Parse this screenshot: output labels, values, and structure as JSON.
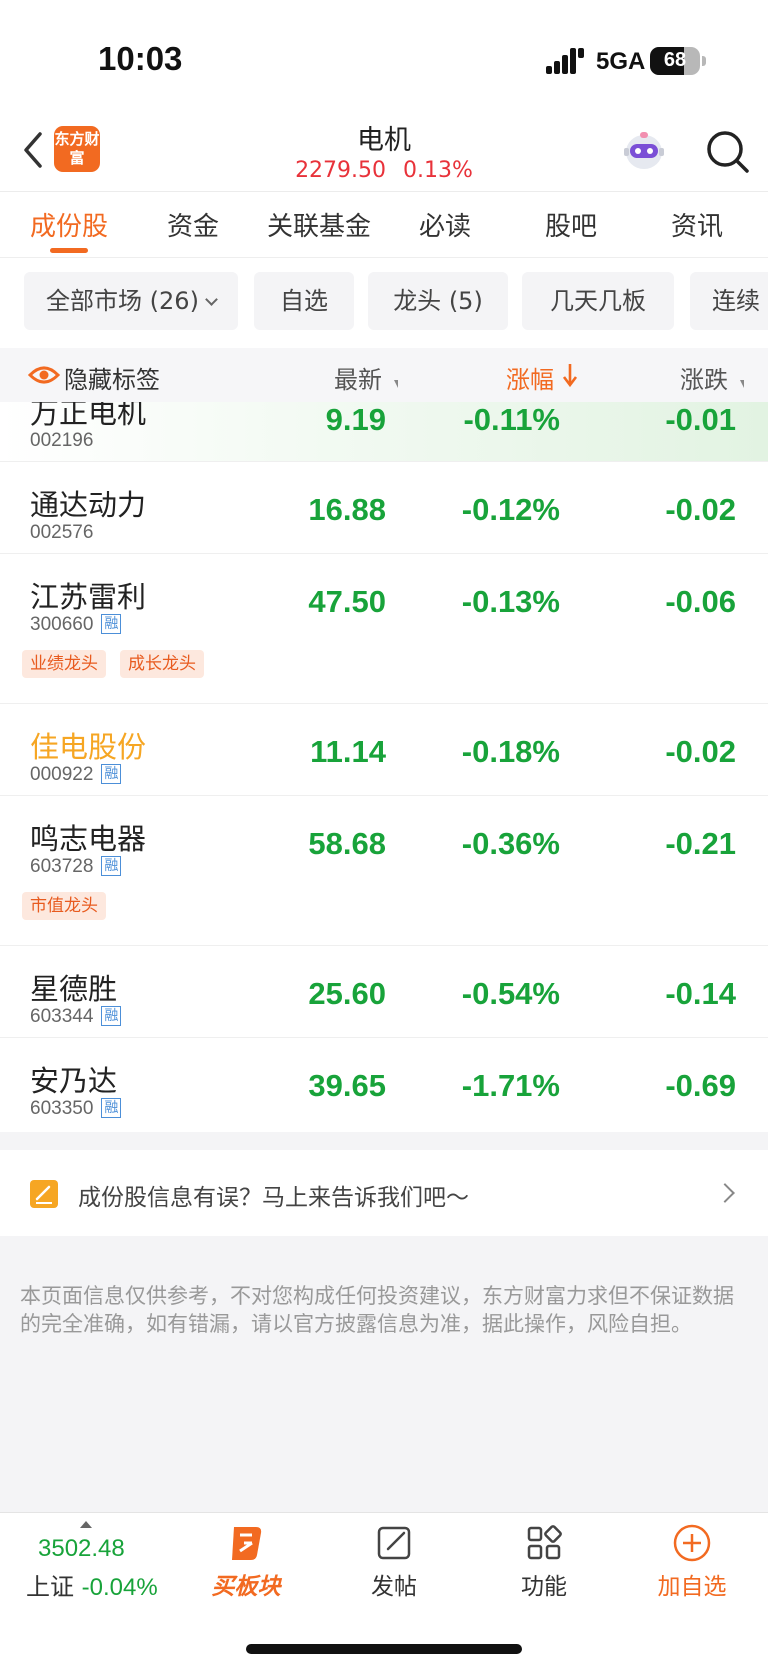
{
  "status_bar": {
    "time": "10:03",
    "network": "5GA",
    "battery": "68",
    "battery_level": 0.68
  },
  "header": {
    "logo_text": "东方财富",
    "title": "电机",
    "price": "2279.50",
    "change": "0.13%"
  },
  "tabs": [
    "成份股",
    "资金",
    "关联基金",
    "必读",
    "股吧",
    "资讯"
  ],
  "filters": [
    "全部市场 (26)",
    "自选",
    "龙头 (5)",
    "几天几板",
    "连续"
  ],
  "table_header": {
    "hide_tags": "隐藏标签",
    "latest": "最新",
    "change_pct": "涨幅",
    "change_amt": "涨跌"
  },
  "stocks": [
    {
      "name": "万正电机",
      "code": "002196",
      "margin": "",
      "price": "9.19",
      "pct": "-0.11%",
      "chg": "-0.01",
      "tags": []
    },
    {
      "name": "通达动力",
      "code": "002576",
      "margin": "",
      "price": "16.88",
      "pct": "-0.12%",
      "chg": "-0.02",
      "tags": []
    },
    {
      "name": "江苏雷利",
      "code": "300660",
      "margin": "融",
      "price": "47.50",
      "pct": "-0.13%",
      "chg": "-0.06",
      "tags": [
        "业绩龙头",
        "成长龙头"
      ]
    },
    {
      "name": "佳电股份",
      "code": "000922",
      "margin": "融",
      "price": "11.14",
      "pct": "-0.18%",
      "chg": "-0.02",
      "tags": []
    },
    {
      "name": "鸣志电器",
      "code": "603728",
      "margin": "融",
      "price": "58.68",
      "pct": "-0.36%",
      "chg": "-0.21",
      "tags": [
        "市值龙头"
      ]
    },
    {
      "name": "星德胜",
      "code": "603344",
      "margin": "融",
      "price": "25.60",
      "pct": "-0.54%",
      "chg": "-0.14",
      "tags": []
    },
    {
      "name": "安乃达",
      "code": "603350",
      "margin": "融",
      "price": "39.65",
      "pct": "-1.71%",
      "chg": "-0.69",
      "tags": []
    }
  ],
  "feedback": {
    "text": "成份股信息有误？马上来告诉我们吧～"
  },
  "disclaimer": "本页面信息仅供参考，不对您构成任何投资建议，东方财富力求但不保证数据的完全准确，如有错漏，请以官方披露信息为准，据此操作，风险自担。",
  "bottom_bar": {
    "index_value": "3502.48",
    "index_name": "上证",
    "index_change": "-0.04%",
    "buy_sector": "买板块",
    "post": "发帖",
    "functions": "功能",
    "add_watch": "加自选"
  },
  "colors": {
    "accent": "#f26a21",
    "up": "#e8323a",
    "down": "#18a33a"
  }
}
